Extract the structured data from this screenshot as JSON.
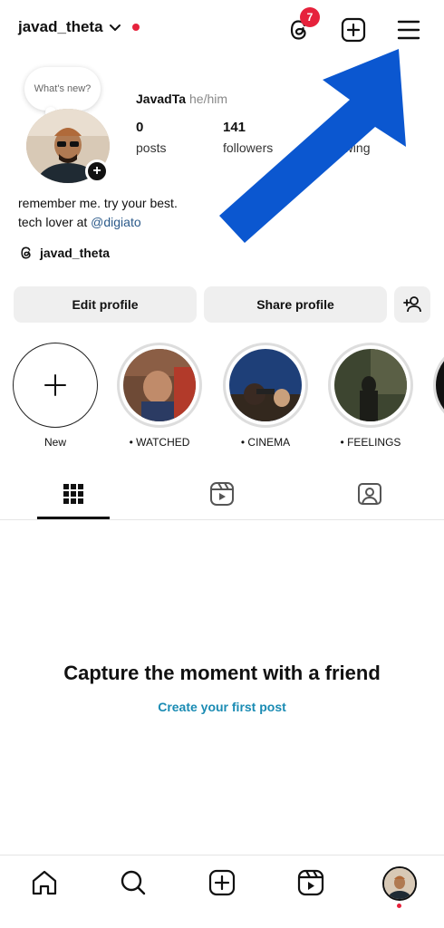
{
  "header": {
    "username": "javad_theta",
    "notification_count": "7",
    "icons": [
      "chevron-down-icon",
      "threads-icon",
      "create-post-icon",
      "menu-icon"
    ]
  },
  "profile": {
    "note_placeholder": "What's new?",
    "display_name": "JavadTa",
    "pronouns": "he/him",
    "stats": [
      {
        "value": "0",
        "label": "posts"
      },
      {
        "value": "141",
        "label": "followers"
      },
      {
        "value": "",
        "label": "following"
      }
    ],
    "bio_line1": "remember me. try your best.",
    "bio_line2_prefix": "tech lover at ",
    "bio_mention": "@digiato",
    "threads_handle": "javad_theta"
  },
  "buttons": {
    "edit_profile": "Edit profile",
    "share_profile": "Share profile"
  },
  "highlights": [
    {
      "label": "New"
    },
    {
      "label": "• WATCHED"
    },
    {
      "label": "• CINEMA"
    },
    {
      "label": "• FEELINGS"
    }
  ],
  "tabs": [
    "grid-icon",
    "reels-icon",
    "tagged-icon"
  ],
  "empty_state": {
    "title": "Capture the moment with a friend",
    "link": "Create your first post"
  },
  "bottom_nav": [
    "home-icon",
    "search-icon",
    "create-icon",
    "reels-icon",
    "profile-avatar"
  ],
  "colors": {
    "accent_red": "#e6223c",
    "link_blue": "#1a8bb3",
    "arrow_blue": "#0b57d0"
  }
}
